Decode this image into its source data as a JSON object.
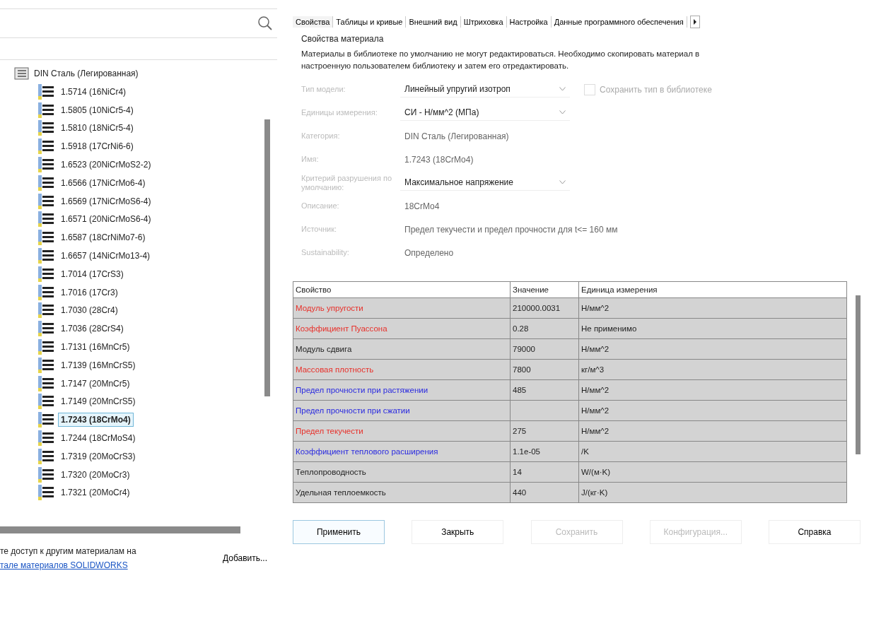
{
  "tree": {
    "label": "DIN Сталь (Легированная)",
    "children": [
      {
        "label": "1.5714 (16NiCr4)",
        "selected": false
      },
      {
        "label": "1.5805 (10NiCr5-4)",
        "selected": false
      },
      {
        "label": "1.5810 (18NiCr5-4)",
        "selected": false
      },
      {
        "label": "1.5918 (17CrNi6-6)",
        "selected": false
      },
      {
        "label": "1.6523 (20NiCrMoS2-2)",
        "selected": false
      },
      {
        "label": "1.6566 (17NiCrMo6-4)",
        "selected": false
      },
      {
        "label": "1.6569 (17NiCrMoS6-4)",
        "selected": false
      },
      {
        "label": "1.6571 (20NiCrMoS6-4)",
        "selected": false
      },
      {
        "label": "1.6587 (18CrNiMo7-6)",
        "selected": false
      },
      {
        "label": "1.6657 (14NiCrMo13-4)",
        "selected": false
      },
      {
        "label": "1.7014 (17CrS3)",
        "selected": false
      },
      {
        "label": "1.7016 (17Cr3)",
        "selected": false
      },
      {
        "label": "1.7030 (28Cr4)",
        "selected": false
      },
      {
        "label": "1.7036 (28CrS4)",
        "selected": false
      },
      {
        "label": "1.7131 (16MnCr5)",
        "selected": false
      },
      {
        "label": "1.7139 (16MnCrS5)",
        "selected": false
      },
      {
        "label": "1.7147 (20MnCr5)",
        "selected": false
      },
      {
        "label": "1.7149 (20MnCrS5)",
        "selected": false
      },
      {
        "label": "1.7243 (18CrMo4)",
        "selected": true
      },
      {
        "label": "1.7244 (18CrMoS4)",
        "selected": false
      },
      {
        "label": "1.7319 (20MoCrS3)",
        "selected": false
      },
      {
        "label": "1.7320 (20MoCr3)",
        "selected": false
      },
      {
        "label": "1.7321 (20MoCr4)",
        "selected": false
      }
    ]
  },
  "footer_text": "те доступ к другим материалам на",
  "footer_link": "тале материалов SOLIDWORKS",
  "add_button": "Добавить...",
  "tabs": [
    {
      "label": "Свойства",
      "selected": true
    },
    {
      "label": "Таблицы и кривые",
      "selected": false
    },
    {
      "label": "Внешний вид",
      "selected": false
    },
    {
      "label": "Штриховка",
      "selected": false
    },
    {
      "label": "Настройка",
      "selected": false
    },
    {
      "label": "Данные программного обеспечения",
      "selected": false
    }
  ],
  "section_title": "Свойства материала",
  "notice": "Материалы в библиотеке по умолчанию не могут редактироваться. Необходимо скопировать материал в настроенную пользователем библиотеку и затем его отредактировать.",
  "form": [
    {
      "label": "Тип модели:",
      "kind": "dropdown",
      "value": "Линейный упругий изотроп"
    },
    {
      "label": "Единицы измерения:",
      "kind": "dropdown",
      "value": "СИ - Н/мм^2 (МПа)"
    },
    {
      "label": "Категория:",
      "kind": "text",
      "value": "DIN Сталь (Легированная)"
    },
    {
      "label": "Имя:",
      "kind": "text",
      "value": "1.7243 (18CrMo4)"
    },
    {
      "label": "Критерий разрушения по умолчанию:",
      "kind": "dropdown",
      "value": "Максимальное напряжение"
    },
    {
      "label": "Описание:",
      "kind": "text",
      "value": "18CrMo4"
    },
    {
      "label": "Источник:",
      "kind": "text",
      "value": "Предел текучести и предел прочности для t<= 160 мм"
    },
    {
      "label": "Sustainability:",
      "kind": "text",
      "value": "Определено"
    }
  ],
  "save_type_checkbox": {
    "label": "Сохранить тип в библиотеке",
    "checked": false,
    "disabled": true
  },
  "table": {
    "columns": [
      "Свойство",
      "Значение",
      "Единица измерения"
    ],
    "rows": [
      {
        "property": "Модуль упругости",
        "value": "210000.0031",
        "unit": "Н/мм^2",
        "color": "#e8302a"
      },
      {
        "property": "Коэффициент Пуассона",
        "value": "0.28",
        "unit": "Не применимо",
        "color": "#e8302a"
      },
      {
        "property": "Модуль сдвига",
        "value": "79000",
        "unit": "Н/мм^2",
        "color": "#222222"
      },
      {
        "property": "Массовая плотность",
        "value": "7800",
        "unit": "кг/м^3",
        "color": "#e8302a"
      },
      {
        "property": "Предел прочности при растяжении",
        "value": "485",
        "unit": "Н/мм^2",
        "color": "#2a2ae0"
      },
      {
        "property": "Предел прочности при сжатии",
        "value": "",
        "unit": "Н/мм^2",
        "color": "#2a2ae0"
      },
      {
        "property": "Предел текучести",
        "value": "275",
        "unit": "Н/мм^2",
        "color": "#e8302a"
      },
      {
        "property": "Коэффициент теплового расширения",
        "value": "1.1e-05",
        "unit": "/K",
        "color": "#2a2ae0"
      },
      {
        "property": "Теплопроводность",
        "value": "14",
        "unit": "W/(м·K)",
        "color": "#222222"
      },
      {
        "property": "Удельная теплоемкость",
        "value": "440",
        "unit": "J/(кг·K)",
        "color": "#222222"
      }
    ]
  },
  "buttons": [
    {
      "label": "Применить",
      "default": true,
      "disabled": false
    },
    {
      "label": "Закрыть",
      "default": false,
      "disabled": false
    },
    {
      "label": "Сохранить",
      "default": false,
      "disabled": true
    },
    {
      "label": "Конфигурация...",
      "default": false,
      "disabled": true
    },
    {
      "label": "Справка",
      "default": false,
      "disabled": false
    }
  ]
}
